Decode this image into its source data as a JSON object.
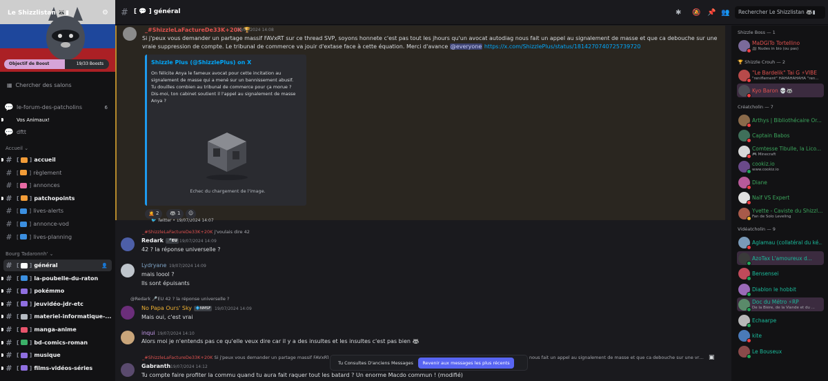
{
  "server": {
    "name": "Le Shizzlistan 🦝▮",
    "boost_label": "Objectif de Boost",
    "boost_count": "19/33 Boosts",
    "boost_progress": 0.58,
    "search_channels": "Chercher des salons"
  },
  "channels": {
    "top": [
      {
        "name": "le-forum-des-patcholins",
        "badge": "6"
      },
      {
        "name": "Vos Animaux!"
      },
      {
        "name": "dftt"
      }
    ],
    "cat_accueil": "Accueil",
    "accueil_items": [
      {
        "name": "accueil",
        "unread": true,
        "color": "#f29c38"
      },
      {
        "name": "règlement",
        "unread": false,
        "color": "#f29c38"
      },
      {
        "name": "annonces",
        "unread": false,
        "color": "#e86aa4"
      },
      {
        "name": "patchopoints",
        "unread": true,
        "color": "#f29c38"
      },
      {
        "name": "lives-alerts",
        "unread": false,
        "color": "#3b8fe0"
      },
      {
        "name": "annonce-vod",
        "unread": false,
        "color": "#3b8fe0"
      },
      {
        "name": "lives-planning",
        "unread": false,
        "color": "#3b8fe0"
      }
    ],
    "cat_bourg": "Bourg Tadaronnh'",
    "bourg_items": [
      {
        "name": "général",
        "unread": true,
        "active": true,
        "color": "#ffffff"
      },
      {
        "name": "la-poubelle-du-raton",
        "unread": true,
        "color": "#3b8fe0"
      },
      {
        "name": "pokémmo",
        "unread": true,
        "color": "#8f6fe0"
      },
      {
        "name": "jeuvidéo-jdr-etc",
        "unread": true,
        "color": "#8f6fe0"
      },
      {
        "name": "materiel-informatique-...",
        "unread": true,
        "color": "#b5bac1"
      },
      {
        "name": "manga-anime",
        "unread": true,
        "color": "#e8546c"
      },
      {
        "name": "bd-comics-roman",
        "unread": true,
        "color": "#3bb068"
      },
      {
        "name": "musique",
        "unread": true,
        "color": "#8f6fe0"
      },
      {
        "name": "films-vidéos-séries",
        "unread": true,
        "color": "#8f6fe0"
      }
    ]
  },
  "header": {
    "title": "[ 💬 ] général",
    "search_placeholder": "Rechercher Le Shizzlistan 🦝▮"
  },
  "messages": [
    {
      "author": "_#ShizzleLaFactureDe33K+20K 🏆",
      "author_color": "#e0524f",
      "time": "19/07/2024 14:08",
      "text": "Si j'peux vous demander un partage massif FAVxRT sur ce thread SVP, soyons honnete c'est pas tout les jhours qu'un avocat autodiag nous fait un appel au signalement de masse et que ca debouche sur une vraie suppression de compte. Le tribunal de commerce va jouir d'extase face à cette équation. Merci d'avance",
      "mention": "@everyone",
      "link": "https://x.com/ShizzlePlus/status/1814270740725739720",
      "embed": {
        "author": "Shizzle Plus (@ShizzlePlus) on X",
        "description": "On félicite Anya le fameux avocat pour cette incitation au signalement de masse qui a mené sur un bannissement abusif. Tu douilles combien au tribunal de commerce pour ça morue ? Dis-moi, ton cabinet soutient il l'appel au signalement de masse Anya ?",
        "image_error": "Echec du chargement de l'image.",
        "footer": "Twitter • 19/07/2024 14:07"
      },
      "reactions": [
        {
          "emoji": "🤦",
          "count": "2"
        },
        {
          "emoji": "🦝",
          "count": "1"
        }
      ]
    },
    {
      "reply_author": "_#ShizzleLaFactureDe33K+20K",
      "reply_text": "j'voulais dire 42",
      "author": "Redark",
      "tag": "🎤EU",
      "author_color": "#f2f3f5",
      "time": "19/07/2024 14:09",
      "lines": [
        "42 ? la réponse universelle ?"
      ]
    },
    {
      "author": "Lydryane",
      "author_color": "#7fa3c4",
      "time": "19/07/2024 14:09",
      "lines": [
        "mais loool ?",
        "Ils sont épuisants"
      ]
    },
    {
      "reply_author": "@Redark 🎤EU",
      "reply_text": "42 ? la réponse universelle ?",
      "author": "No Papa Ours' Sky",
      "tag": "💠NMSF",
      "author_color": "#f0b232",
      "time": "19/07/2024 14:09",
      "lines": [
        "Mais oui, c'est vrai"
      ]
    },
    {
      "author": "inqui",
      "author_color": "#c99cf0",
      "time": "19/07/2024 14:10",
      "lines": [
        "Alors moi je n'entends pas ce qu'elle veux dire car il y a des insultes et les insultes c'est pas bien 🦝"
      ]
    },
    {
      "reply_author": "_#ShizzleLaFactureDe33K+20K",
      "reply_text": "Si j'peux vous demander un partage massif FAVxRT sur ce thread SVP, soyons honnete c'est pas tout les jhours qu'un avocat autodiag nous fait un appel au signalement de masse et que ca debouche sur une vraie s...",
      "author": "Gabranth",
      "author_color": "#f2f3f5",
      "time": "19/07/2024 14:12",
      "lines": [
        "Tu compte faire profiter la commu quand tu aura fait raquer tout les batard ? Un enorme Macdo commun ! (modifié)"
      ]
    }
  ],
  "notice": {
    "text": "Tu Consultes D'anciens Messages",
    "button": "Revenir aux messages les plus récents"
  },
  "members": {
    "groups": [
      {
        "title": "Shizzle Boss — 1",
        "items": [
          {
            "name": "MaDGiTo Tortellino",
            "sub": "🎥 Nudes in bio (ou pas)",
            "color": "#e0524f",
            "status": "#f23f43"
          }
        ]
      },
      {
        "title": "🏆 Shizzle Crouh — 2",
        "items": [
          {
            "name": "\"Le Bardelik\" Tai G ⚡VIBE",
            "sub": "\"reniflement\" HAHAHAHAHA \"ren...",
            "color": "#e0524f",
            "status": "#f23f43"
          },
          {
            "name": "Kyo Baron 💀🦝",
            "sub": "",
            "color": "#e0524f",
            "status": "#f23f43",
            "highlight": true
          }
        ]
      },
      {
        "title": "Créatcholin — 7",
        "items": [
          {
            "name": "Arthys | Bibliothécaire Or...",
            "sub": "",
            "color": "#3ba55c",
            "status": "#f23f43"
          },
          {
            "name": "Captain Babos",
            "sub": "",
            "color": "#3ba55c",
            "status": "#f23f43"
          },
          {
            "name": "Comtesse Tibulle, la Lico...",
            "sub": "🎮 Minecraft",
            "color": "#3ba55c",
            "status": "#f23f43"
          },
          {
            "name": "cookiz.io",
            "sub": "www.cookiz.io",
            "color": "#3ba55c",
            "status": "#23a55a"
          },
          {
            "name": "Diane",
            "sub": "",
            "color": "#3ba55c",
            "status": "#f23f43"
          },
          {
            "name": "Naïf VS Expert",
            "sub": "",
            "color": "#3ba55c",
            "status": "#f23f43"
          },
          {
            "name": "Yvette - Caviste du Shizzl...",
            "sub": "Fan de Solo Leveling",
            "color": "#3ba55c",
            "status": "#f0b232"
          }
        ]
      },
      {
        "title": "Vidéatcholin — 9",
        "items": [
          {
            "name": "Aglamau (collatéral du ké...",
            "sub": "",
            "color": "#1abc9c",
            "status": "#f23f43"
          },
          {
            "name": "AzoTax L'amoureux d...",
            "sub": "",
            "color": "#1abc9c",
            "status": "#23a55a",
            "highlight": true
          },
          {
            "name": "Bensensei",
            "sub": "",
            "color": "#1abc9c",
            "status": "#23a55a"
          },
          {
            "name": "Diablon le hobbit",
            "sub": "",
            "color": "#1abc9c",
            "status": "#23a55a"
          },
          {
            "name": "Doc du Métro ⚡RP",
            "sub": "De la Bière, de la Viande et du ...",
            "color": "#1abc9c",
            "status": "#23a55a",
            "highlight": true
          },
          {
            "name": "Echaarpe",
            "sub": "",
            "color": "#1abc9c",
            "status": "#23a55a"
          },
          {
            "name": "kite",
            "sub": "",
            "color": "#1abc9c",
            "status": "#f23f43"
          },
          {
            "name": "Le Bouseux",
            "sub": "",
            "color": "#1abc9c",
            "status": "#23a55a"
          }
        ]
      }
    ]
  }
}
